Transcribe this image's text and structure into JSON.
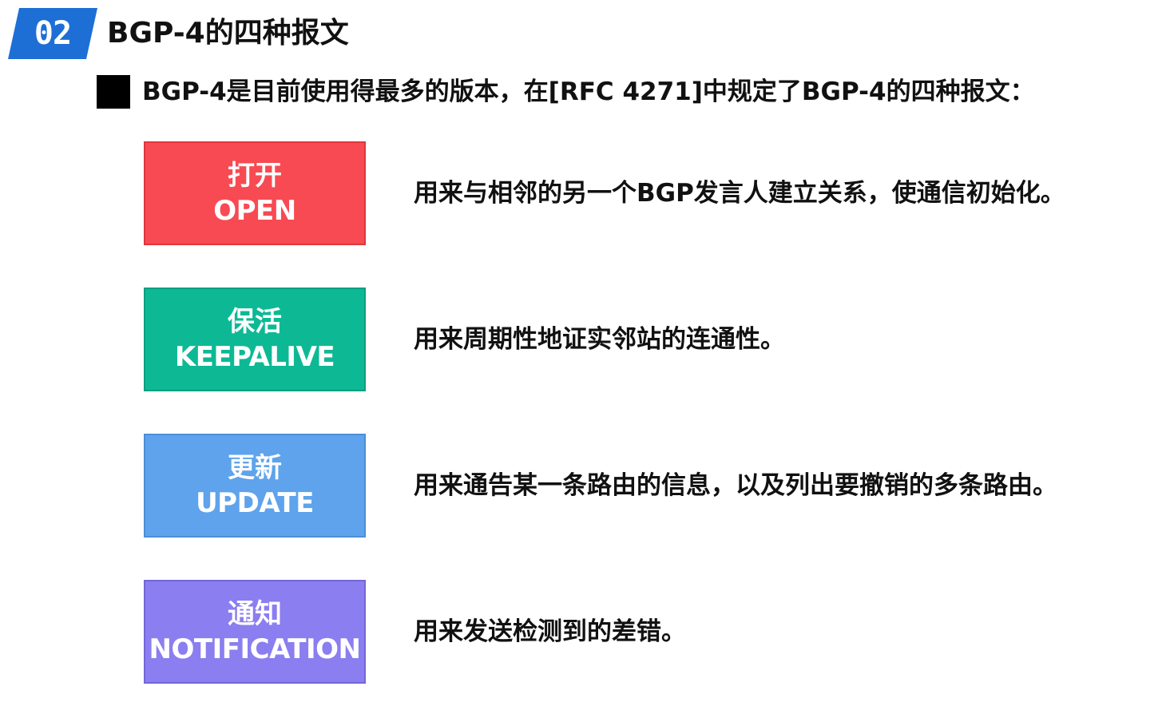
{
  "section": {
    "number": "02",
    "title": "BGP-4的四种报文"
  },
  "intro": "BGP-4是目前使用得最多的版本，在[RFC 4271]中规定了BGP-4的四种报文：",
  "colors": {
    "badge": "#1d6fd6",
    "open": "#f84a52",
    "keepalive": "#0db995",
    "update": "#5ea3ec",
    "notification": "#8b7ef0"
  },
  "messages": [
    {
      "cn": "打开",
      "en": "OPEN",
      "description": "用来与相邻的另一个BGP发言人建立关系，使通信初始化。"
    },
    {
      "cn": "保活",
      "en": "KEEPALIVE",
      "description": "用来周期性地证实邻站的连通性。"
    },
    {
      "cn": "更新",
      "en": "UPDATE",
      "description": "用来通告某一条路由的信息，以及列出要撤销的多条路由。"
    },
    {
      "cn": "通知",
      "en": "NOTIFICATION",
      "description": "用来发送检测到的差错。"
    }
  ]
}
